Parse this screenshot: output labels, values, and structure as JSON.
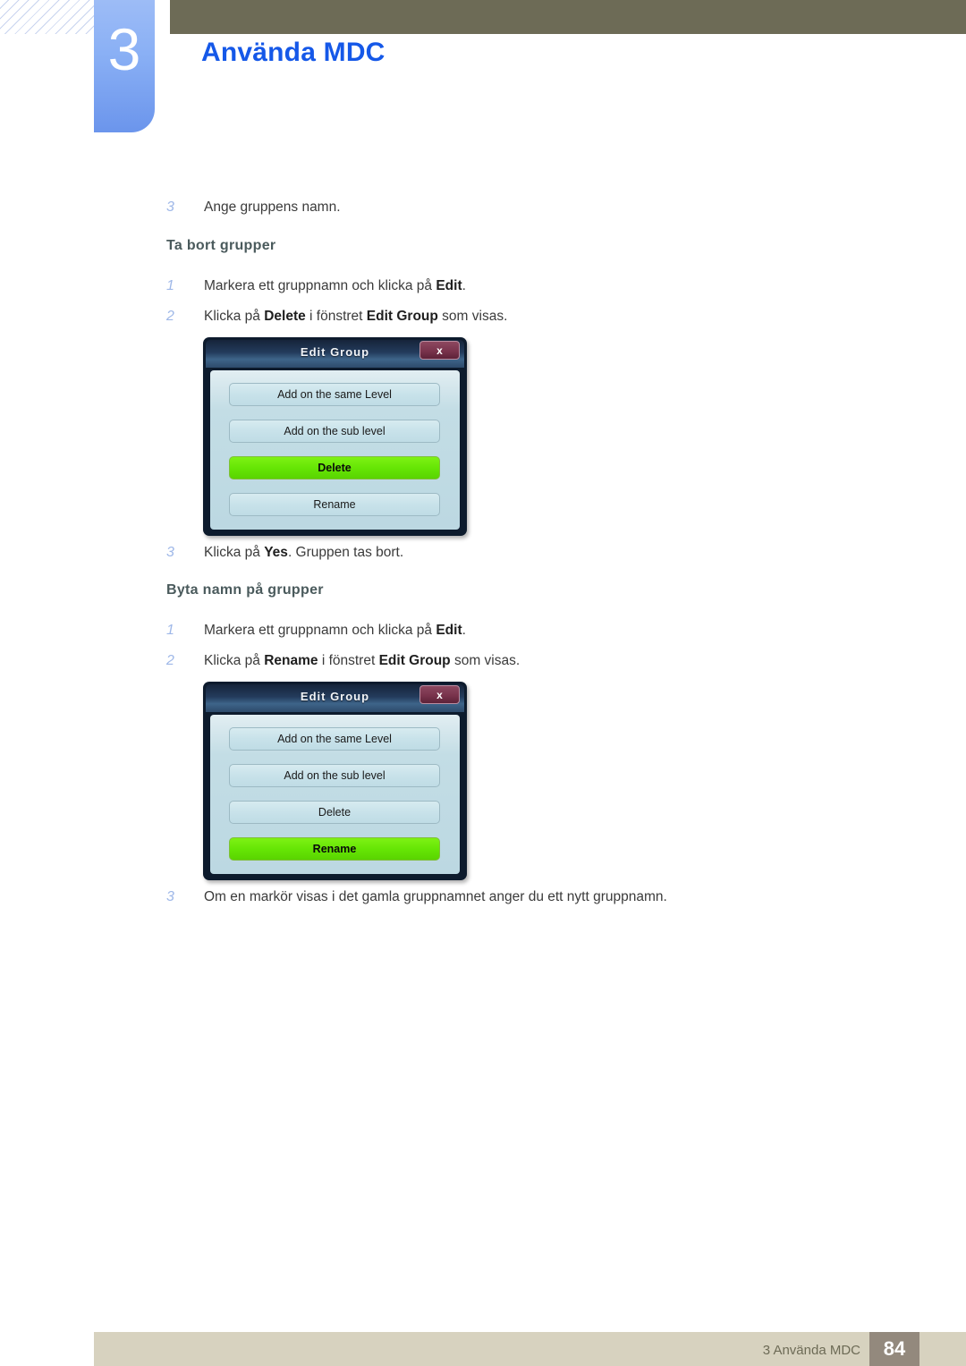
{
  "header": {
    "chapter_number": "3",
    "chapter_title": "Använda MDC"
  },
  "content": {
    "steps": [
      {
        "marker": "3",
        "html": "Ange gruppens namn."
      }
    ],
    "section_delete": {
      "heading": "Ta bort grupper",
      "steps": [
        {
          "marker": "1",
          "html": "Markera ett gruppnamn och klicka på <b>Edit</b>."
        },
        {
          "marker": "2",
          "html": "Klicka på <b>Delete</b> i fönstret <b>Edit Group</b> som visas."
        },
        {
          "marker": "3",
          "html": "Klicka på <b>Yes</b>. Gruppen tas bort."
        }
      ]
    },
    "section_rename": {
      "heading": "Byta namn på grupper",
      "steps": [
        {
          "marker": "1",
          "html": "Markera ett gruppnamn och klicka på <b>Edit</b>."
        },
        {
          "marker": "2",
          "html": "Klicka på <b>Rename</b> i fönstret <b>Edit Group</b> som visas."
        },
        {
          "marker": "3",
          "html": "Om en markör visas i det gamla gruppnamnet anger du ett nytt gruppnamn."
        }
      ]
    }
  },
  "dialogs": [
    {
      "title": "Edit Group",
      "close_label": "x",
      "buttons": [
        {
          "label": "Add on the same Level",
          "selected": false
        },
        {
          "label": "Add on the sub level",
          "selected": false
        },
        {
          "label": "Delete",
          "selected": true
        },
        {
          "label": "Rename",
          "selected": false
        }
      ]
    },
    {
      "title": "Edit Group",
      "close_label": "x",
      "buttons": [
        {
          "label": "Add on the same Level",
          "selected": false
        },
        {
          "label": "Add on the sub level",
          "selected": false
        },
        {
          "label": "Delete",
          "selected": false
        },
        {
          "label": "Rename",
          "selected": true
        }
      ]
    }
  ],
  "footer": {
    "text": "3 Använda MDC",
    "page_number": "84"
  },
  "colors": {
    "header_bar": "#6d6b56",
    "chapter_tab": "#8ab0f5",
    "chapter_title": "#1558e8",
    "heading": "#4a5a5c",
    "marker": "#9fb8e8",
    "footer_bar": "#d7d2bf",
    "footer_page_box": "#93897d",
    "dialog_selected": "#66e605"
  }
}
